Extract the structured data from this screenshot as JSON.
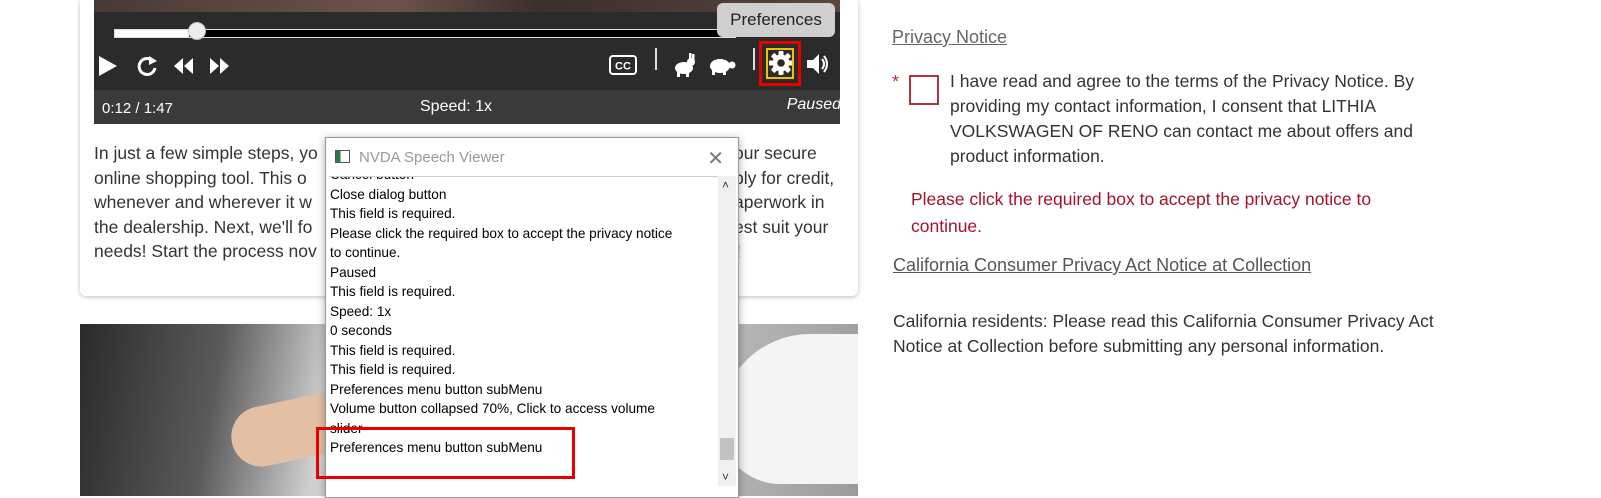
{
  "player": {
    "tooltip": "Preferences",
    "time": "0:12 / 1:47",
    "speed": "Speed: 1x",
    "state": "Paused",
    "progress_fraction": 0.12,
    "controls": [
      "play-icon",
      "replay-icon",
      "rewind-icon",
      "fast-forward-icon",
      "closed-captions-icon",
      "faster-rabbit-icon",
      "slower-turtle-icon",
      "gear-icon",
      "volume-icon"
    ],
    "cc_label": "CC"
  },
  "intro": {
    "text": "In just a few simple steps, yo…our secure online shopping tool. This o…ply for credit, whenever and wherever it w…aperwork in the dealership. Next, we'll fo…est suit your needs! Start the process nov…!",
    "lines": [
      [
        "In just a few simple steps, yo",
        "our secure"
      ],
      [
        "online shopping tool. This o",
        "ply for credit,"
      ],
      [
        "whenever and wherever it w",
        "aperwork in"
      ],
      [
        "the dealership. Next, we'll fo",
        "est suit your"
      ],
      [
        "needs! Start the process nov",
        "!"
      ]
    ]
  },
  "nvda": {
    "title": "NVDA Speech Viewer",
    "close": "✕",
    "lines": [
      "Cancel  button",
      "Close dialog  button",
      "This field is required.",
      "Please click the required box to accept the privacy notice",
      "to continue.",
      "Paused",
      "This field is required.",
      "Speed: 1x",
      "0 seconds",
      "This field is required.",
      "This field is required.",
      "Preferences  menu button  subMenu",
      "Volume  button  collapsed    70%, Click to access volume",
      "slider",
      "Preferences  menu button  subMenu"
    ]
  },
  "form": {
    "privacy_link": "Privacy Notice",
    "required_mark": "*",
    "agree_text": "I have read and agree to the terms of the Privacy Notice. By providing my contact information, I consent that LITHIA VOLKSWAGEN OF RENO can contact me about offers and product information.",
    "error_text": "Please click the required box to accept the privacy notice to continue.",
    "ccpa_link": "California Consumer Privacy Act Notice at Collection",
    "ccpa_text": "California residents: Please read this California Consumer Privacy Act Notice at Collection before submitting any personal information.",
    "accent_color": "#a4132b"
  }
}
